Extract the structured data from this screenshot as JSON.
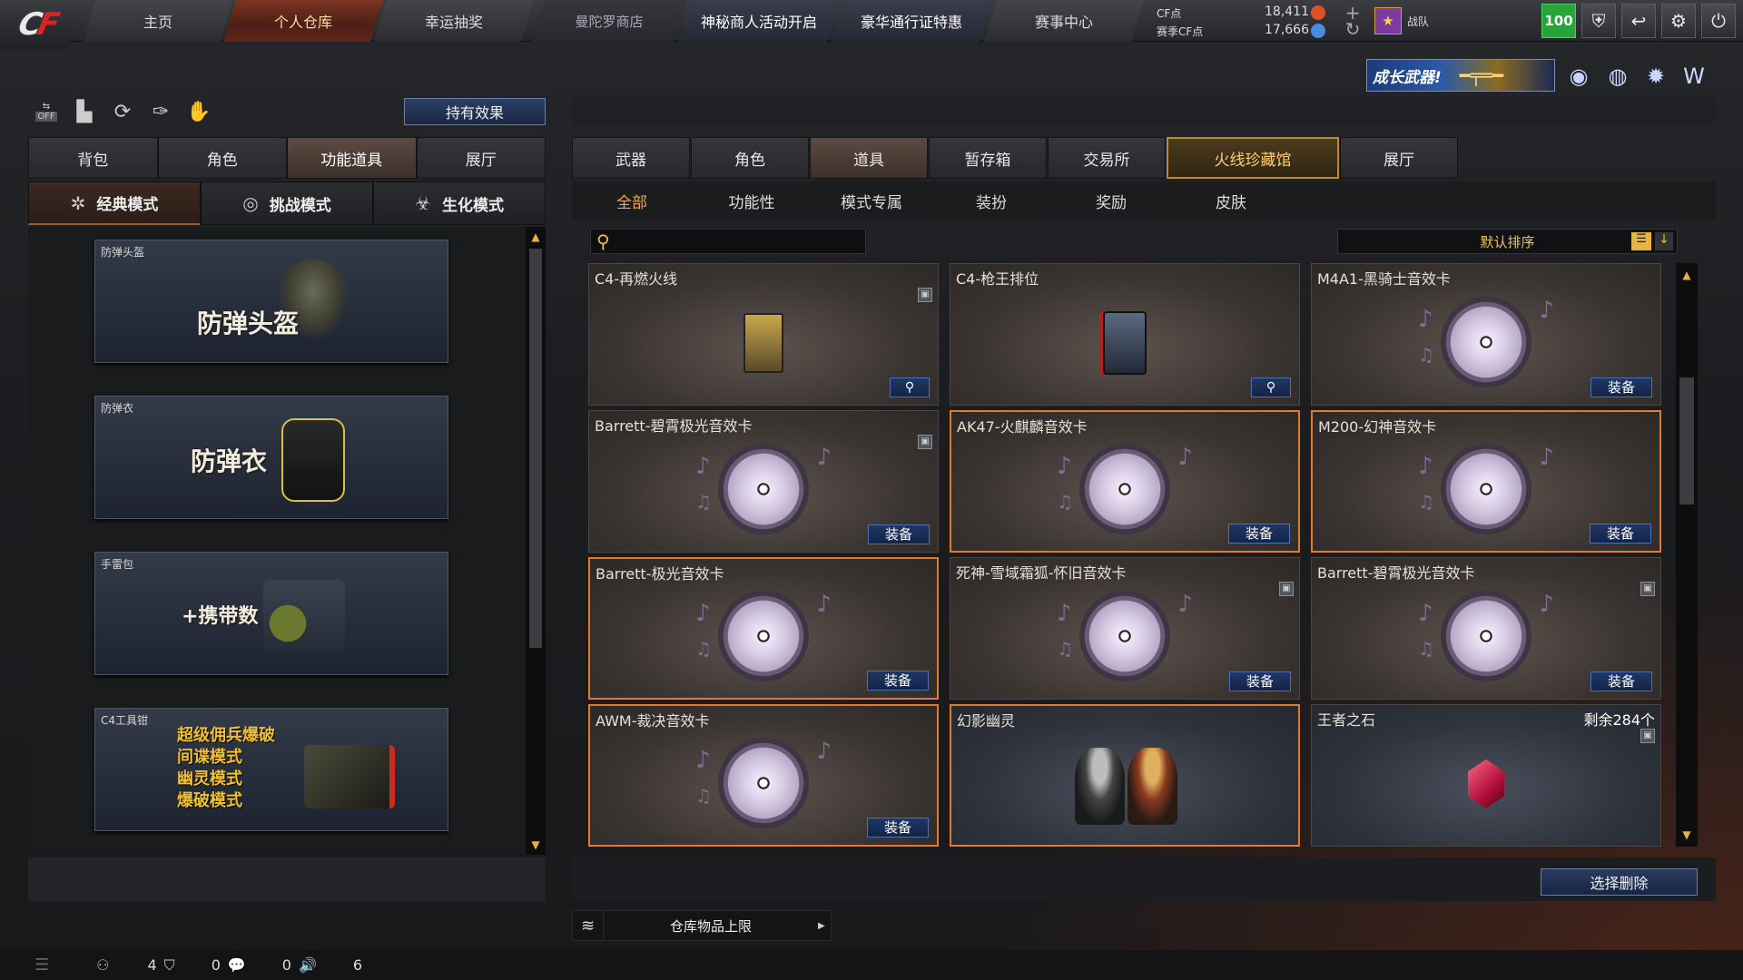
{
  "nav": {
    "items": [
      "主页",
      "个人仓库",
      "幸运抽奖",
      "曼陀罗商店",
      "神秘商人活动开启",
      "豪华通行证特惠",
      "赛事中心"
    ],
    "active_index": 1,
    "currency": {
      "cf_label": "CF点",
      "cf_value": "18,411",
      "season_label": "赛季CF点",
      "season_value": "17,666"
    },
    "clan_label": "战队",
    "level": "100"
  },
  "banner": {
    "grow_weapon": "成长武器!"
  },
  "left": {
    "hold_effect": "持有效果",
    "tabs": [
      "背包",
      "角色",
      "功能道具",
      "展厅"
    ],
    "active_tab": 2,
    "modes": [
      "经典模式",
      "挑战模式",
      "生化模式"
    ],
    "active_mode": 0,
    "cards": [
      {
        "caption": "防弹头盔",
        "big": "防弹头盔"
      },
      {
        "caption": "防弹衣",
        "big": "防弹衣"
      },
      {
        "caption": "手雷包",
        "big": "+携带数"
      },
      {
        "caption": "C4工具钳",
        "lines": [
          "超级佣兵爆破",
          "间谍模式",
          "幽灵模式",
          "爆破模式"
        ]
      }
    ]
  },
  "right": {
    "tabs": [
      "武器",
      "角色",
      "道具",
      "暂存箱",
      "交易所",
      "火线珍藏馆",
      "展厅"
    ],
    "active_tab": 2,
    "highlight_tab": 5,
    "subtabs": [
      "全部",
      "功能性",
      "模式专属",
      "装扮",
      "奖励",
      "皮肤"
    ],
    "active_subtab": 0,
    "sort_label": "默认排序",
    "equip_label": "装备",
    "delete_label": "选择删除",
    "capacity_label": "仓库物品上限",
    "items": [
      {
        "title": "C4-再燃火线",
        "type": "c4",
        "action": "search",
        "lock": true
      },
      {
        "title": "C4-枪王排位",
        "type": "c4b",
        "action": "search"
      },
      {
        "title": "M4A1-黑骑士音效卡",
        "type": "disc",
        "action": "equip"
      },
      {
        "title": "Barrett-碧霄极光音效卡",
        "type": "disc",
        "action": "equip",
        "lock": true
      },
      {
        "title": "AK47-火麒麟音效卡",
        "type": "disc",
        "action": "equip",
        "selected": true
      },
      {
        "title": "M200-幻神音效卡",
        "type": "disc",
        "action": "equip",
        "selected": true
      },
      {
        "title": "Barrett-极光音效卡",
        "type": "disc",
        "action": "equip",
        "selected": true
      },
      {
        "title": "死神-雪域霜狐-怀旧音效卡",
        "type": "disc",
        "action": "equip",
        "lock": true
      },
      {
        "title": "Barrett-碧霄极光音效卡",
        "type": "disc",
        "action": "equip",
        "lock": true
      },
      {
        "title": "AWM-裁决音效卡",
        "type": "disc",
        "action": "equip",
        "selected": true
      },
      {
        "title": "幻影幽灵",
        "type": "ghost",
        "selected": true,
        "blue": true
      },
      {
        "title": "王者之石",
        "type": "gem",
        "count": "剩余284个",
        "lock": true,
        "blue": true
      }
    ]
  },
  "status": {
    "v1": "4",
    "v2": "0",
    "v3": "0",
    "v4": "6"
  }
}
